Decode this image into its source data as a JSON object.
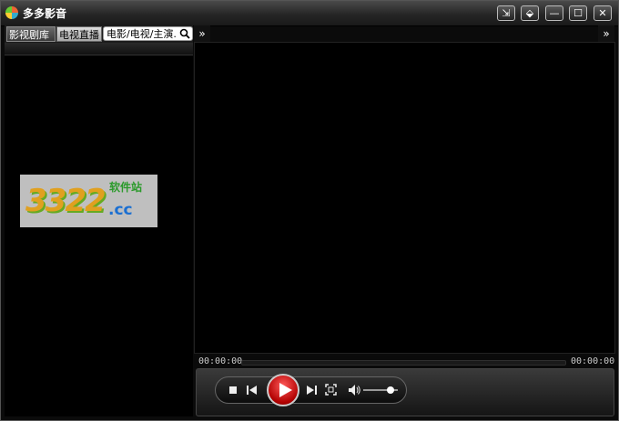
{
  "window": {
    "title": "多多影音"
  },
  "title_buttons": [
    "⇲",
    "⬙",
    "—",
    "☐",
    "✕"
  ],
  "left_panel": {
    "tabs": [
      {
        "label": "影视剧库",
        "active": true
      },
      {
        "label": "电视直播",
        "active": false
      }
    ],
    "search": {
      "value": "电影/电视/主演."
    },
    "expand_label": "»"
  },
  "logo": {
    "number": "3322",
    "domain": ".cc",
    "site_label": "软件站"
  },
  "player": {
    "expand_label": "»",
    "time_current": "00:00:00",
    "time_total": "00:00:00",
    "progress": 0,
    "volume": 0.7
  },
  "icons": {
    "search": "search-icon",
    "stop": "stop-icon",
    "prev": "previous-icon",
    "play": "play-icon",
    "next": "next-icon",
    "fullscreen": "fullscreen-icon",
    "volume": "volume-icon"
  },
  "colors": {
    "accent": "#c00000",
    "background": "#000000"
  }
}
